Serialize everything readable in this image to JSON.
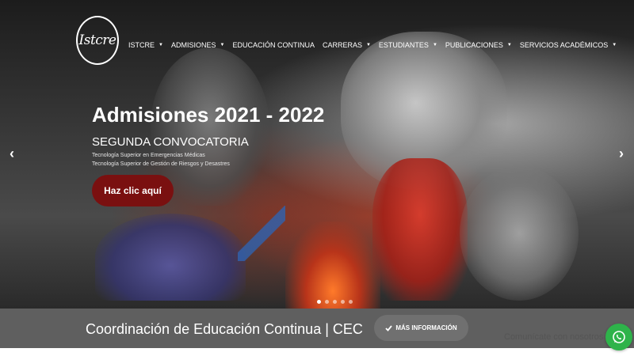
{
  "brand": {
    "logo_text": "Istcre"
  },
  "nav": {
    "items": [
      {
        "label": "ISTCRE",
        "has_dropdown": true
      },
      {
        "label": "ADMISIONES",
        "has_dropdown": true
      },
      {
        "label": "EDUCACIÓN CONTINUA",
        "has_dropdown": false
      },
      {
        "label": "CARRERAS",
        "has_dropdown": true
      },
      {
        "label": "ESTUDIANTES",
        "has_dropdown": true
      },
      {
        "label": "PUBLICACIONES",
        "has_dropdown": true
      },
      {
        "label": "SERVICIOS ACADÉMICOS",
        "has_dropdown": true
      }
    ],
    "caret": "▼"
  },
  "hero": {
    "title": "Admisiones 2021 - 2022",
    "subtitle": "SEGUNDA CONVOCATORIA",
    "lines": [
      "Tecnología Superior en Emergencias Médicas",
      "Tecnología Superior de Gestión de Riesgos y Desastres"
    ],
    "cta_label": "Haz clic aquí",
    "prev_icon": "‹",
    "next_icon": "›",
    "slide_count": 5,
    "active_slide": 0
  },
  "band": {
    "title": "Coordinación de Educación Continua | CEC",
    "button_label": "MÁS INFORMACIÓN",
    "button_icon": "check-icon"
  },
  "chat": {
    "label": "Comunícate con nosotros",
    "icon": "whatsapp-icon"
  },
  "colors": {
    "cta_bg": "#7a1010",
    "band_bg": "#5f5f5f",
    "whatsapp": "#2eb34a"
  }
}
